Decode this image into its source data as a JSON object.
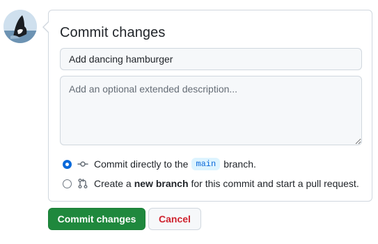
{
  "avatar": {
    "alt": "orca avatar"
  },
  "form": {
    "title": "Commit changes",
    "summary_value": "Add dancing hamburger",
    "description_placeholder": "Add an optional extended description...",
    "options": [
      {
        "selected": true,
        "icon": "git-commit-icon",
        "text_before": "Commit directly to the",
        "branch": "main",
        "text_after": "branch."
      },
      {
        "selected": false,
        "icon": "git-pull-request-icon",
        "text_before": "Create a",
        "emphasis": "new branch",
        "text_after": "for this commit and start a pull request."
      }
    ]
  },
  "actions": {
    "commit_label": "Commit changes",
    "cancel_label": "Cancel"
  },
  "colors": {
    "primary_button": "#1f883d",
    "cancel_text": "#cf222e",
    "accent": "#0969da",
    "branch_badge_bg": "#ddf4ff"
  }
}
